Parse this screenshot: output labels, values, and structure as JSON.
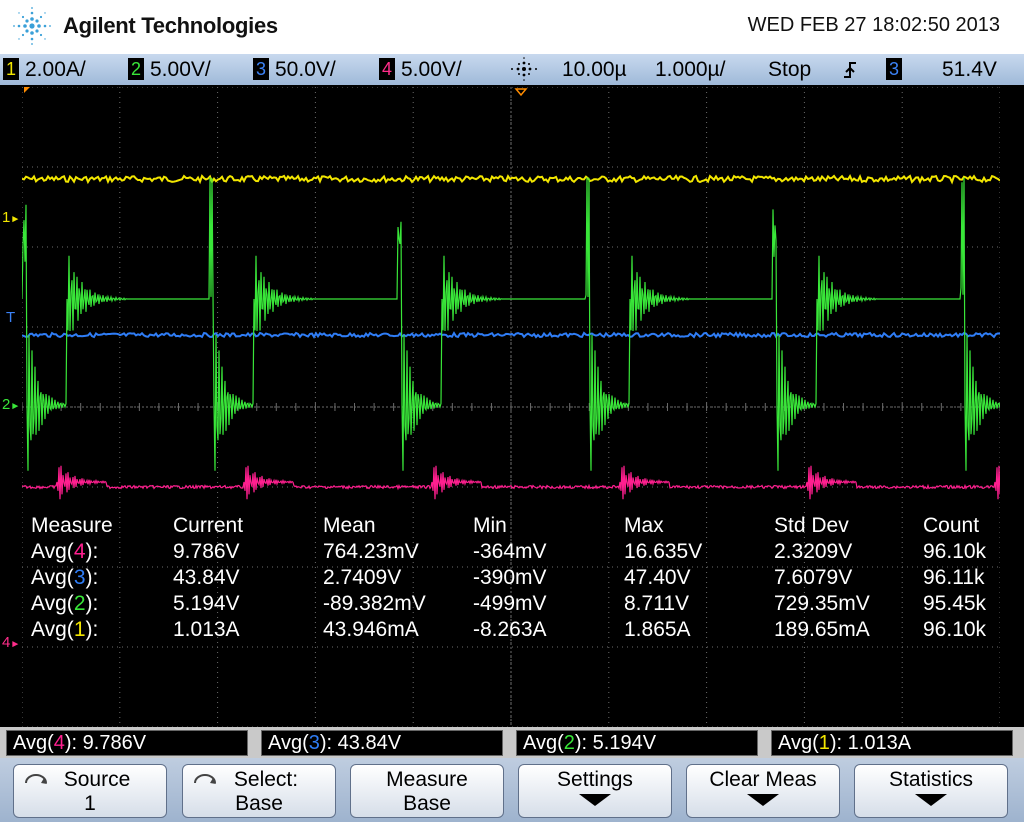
{
  "header": {
    "brand": "Agilent Technologies",
    "datetime": "WED FEB 27 18:02:50 2013"
  },
  "statusbar": {
    "channels": [
      {
        "num": "1",
        "scale": "2.00A/",
        "color": "#f2e600"
      },
      {
        "num": "2",
        "scale": "5.00V/",
        "color": "#39e639"
      },
      {
        "num": "3",
        "scale": "50.0V/",
        "color": "#3b82f6"
      },
      {
        "num": "4",
        "scale": "5.00V/",
        "color": "#ff2d8a"
      }
    ],
    "timebase_pos": "10.00µ",
    "timebase_scale": "1.000µ/",
    "run_state": "Stop",
    "trigger_source": "3",
    "trigger_level": "51.4V"
  },
  "markers": {
    "ch1": "1",
    "trig": "T",
    "ch2": "2",
    "ch4": "4"
  },
  "measurements": {
    "headers": [
      "Measure",
      "Current",
      "Mean",
      "Min",
      "Max",
      "Std Dev",
      "Count"
    ],
    "rows": [
      {
        "label_pre": "Avg(",
        "ch": "4",
        "label_post": "):",
        "current": "9.786V",
        "mean": "764.23mV",
        "min": "-364mV",
        "max": "16.635V",
        "stddev": "2.3209V",
        "count": "96.10k"
      },
      {
        "label_pre": "Avg(",
        "ch": "3",
        "label_post": "):",
        "current": "43.84V",
        "mean": "2.7409V",
        "min": "-390mV",
        "max": "47.40V",
        "stddev": "7.6079V",
        "count": "96.11k"
      },
      {
        "label_pre": "Avg(",
        "ch": "2",
        "label_post": "):",
        "current": "5.194V",
        "mean": "-89.382mV",
        "min": "-499mV",
        "max": "8.711V",
        "stddev": "729.35mV",
        "count": "95.45k"
      },
      {
        "label_pre": "Avg(",
        "ch": "1",
        "label_post": "):",
        "current": "1.013A",
        "mean": "43.946mA",
        "min": "-8.263A",
        "max": "1.865A",
        "stddev": "189.65mA",
        "count": "96.10k"
      }
    ]
  },
  "readouts": [
    {
      "pre": "Avg(",
      "ch": "4",
      "post": "): 9.786V"
    },
    {
      "pre": "Avg(",
      "ch": "3",
      "post": "): 43.84V"
    },
    {
      "pre": "Avg(",
      "ch": "2",
      "post": "): 5.194V"
    },
    {
      "pre": "Avg(",
      "ch": "1",
      "post": "): 1.013A"
    }
  ],
  "softkeys": [
    {
      "line1": "Source",
      "line2": "1",
      "icon": "rotate-knob-icon"
    },
    {
      "line1": "Select:",
      "line2": "Base",
      "icon": "rotate-knob-icon"
    },
    {
      "line1": "Measure",
      "line2": "Base",
      "icon": ""
    },
    {
      "line1": "Settings",
      "line2": "",
      "icon": "arrow-down-icon"
    },
    {
      "line1": "Clear Meas",
      "line2": "",
      "icon": "arrow-down-icon"
    },
    {
      "line1": "Statistics",
      "line2": "",
      "icon": "arrow-down-icon"
    }
  ],
  "colors": {
    "ch1": "#f2e600",
    "ch2": "#39e639",
    "ch3": "#2f7df6",
    "ch4": "#ff1f8f",
    "grid": "#6b6b6b"
  }
}
